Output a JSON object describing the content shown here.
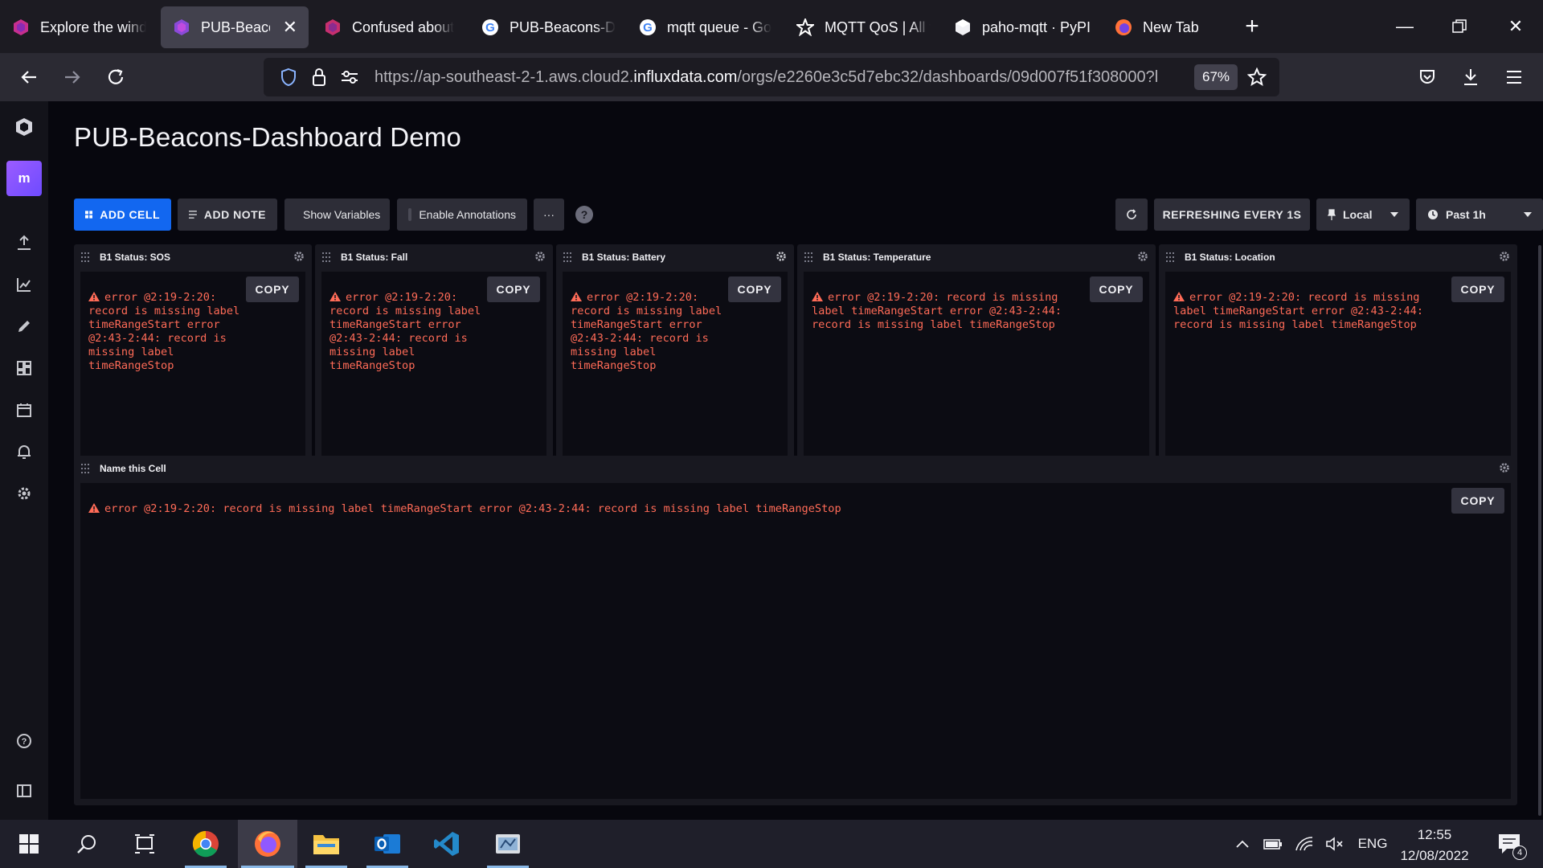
{
  "browser": {
    "tabs": [
      {
        "title": "Explore the wind",
        "icon": "influx-favicon-icon",
        "active": false
      },
      {
        "title": "PUB-Beacons-",
        "icon": "influx-favicon-icon",
        "active": true
      },
      {
        "title": "Confused about",
        "icon": "influx-favicon-icon",
        "active": false
      },
      {
        "title": "PUB-Beacons-Da",
        "icon": "google-favicon-icon",
        "active": false
      },
      {
        "title": "mqtt queue - Go",
        "icon": "google-favicon-icon",
        "active": false
      },
      {
        "title": "MQTT QoS | All t",
        "icon": "star-favicon-icon",
        "active": false
      },
      {
        "title": "paho-mqtt · PyPI",
        "icon": "pypi-favicon-icon",
        "active": false
      },
      {
        "title": "New Tab",
        "icon": "firefox-favicon-icon",
        "active": false
      }
    ],
    "url_prefix": "https://ap-southeast-2-1.aws.cloud2.",
    "url_host": "influxdata.com",
    "url_path": "/orgs/e2260e3c5d7ebc32/dashboards/09d007f51f308000?l",
    "zoom": "67%"
  },
  "sidebar": {
    "org_initial": "m"
  },
  "dashboard": {
    "title": "PUB-Beacons-Dashboard Demo",
    "toolbar": {
      "add_cell": "ADD CELL",
      "add_note": "ADD NOTE",
      "show_variables": "Show Variables",
      "enable_annotations": "Enable Annotations",
      "more": "···",
      "help": "?",
      "refreshing": "REFRESHING EVERY 1S",
      "timezone": "Local",
      "time_range": "Past 1h"
    },
    "copy_label": "COPY",
    "cells": [
      {
        "title": "B1 Status: SOS",
        "error": "error @2:19-2:20: record is missing label timeRangeStart error @2:43-2:44: record is missing label timeRangeStop"
      },
      {
        "title": "B1 Status: Fall",
        "error": "error @2:19-2:20: record is missing label timeRangeStart error @2:43-2:44: record is missing label timeRangeStop"
      },
      {
        "title": "B1 Status: Battery",
        "error": "error @2:19-2:20: record is missing label timeRangeStart error @2:43-2:44: record is missing label timeRangeStop"
      },
      {
        "title": "B1 Status: Temperature",
        "error": "error @2:19-2:20: record is missing label timeRangeStart error @2:43-2:44: record is missing label timeRangeStop"
      },
      {
        "title": "B1 Status: Location",
        "error": "error @2:19-2:20: record is missing label timeRangeStart error @2:43-2:44: record is missing label timeRangeStop"
      },
      {
        "title": "Name this Cell",
        "error": "error @2:19-2:20: record is missing label timeRangeStart error @2:43-2:44: record is missing label timeRangeStop"
      }
    ]
  },
  "taskbar": {
    "language": "ENG",
    "time": "12:55",
    "date": "12/08/2022",
    "notifications": "4"
  },
  "colors": {
    "accent": "#1267f0",
    "error": "#ff6b57",
    "background": "#07070e",
    "cell": "#181820"
  }
}
